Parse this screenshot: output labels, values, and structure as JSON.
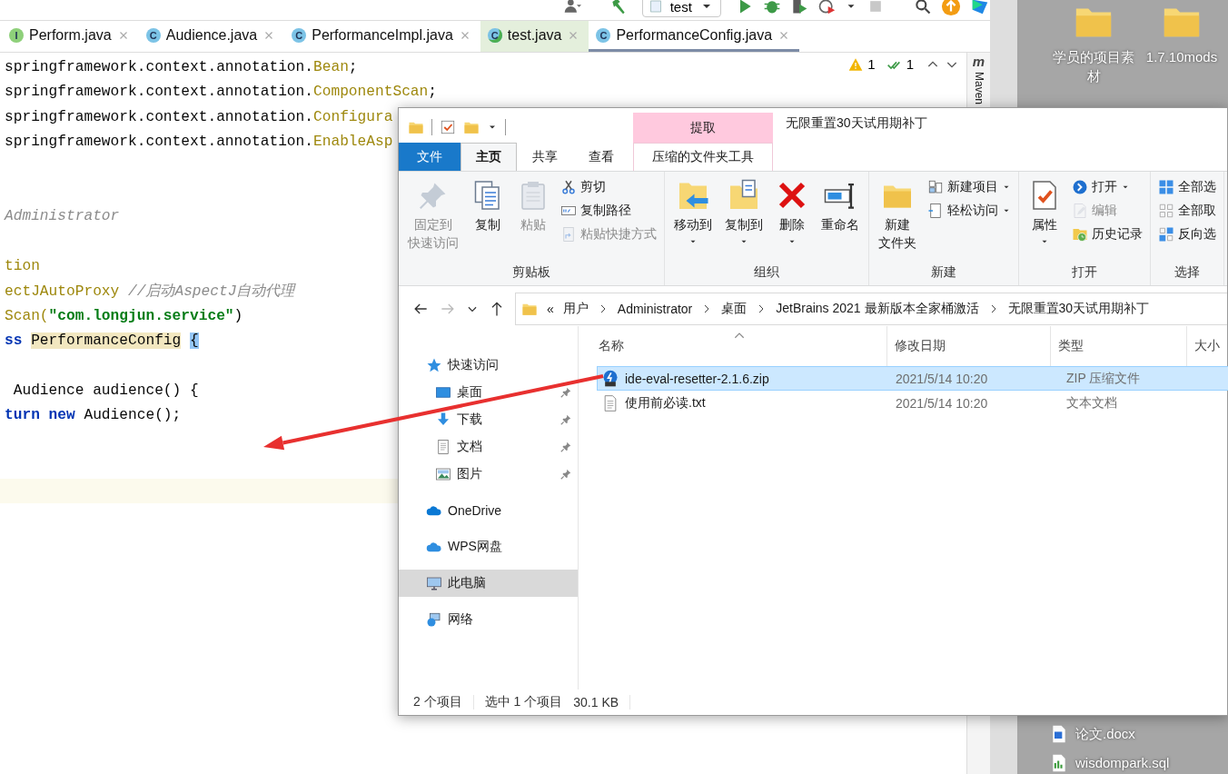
{
  "ide": {
    "toolbar": {
      "run_config": "test"
    },
    "tabs": [
      {
        "label": "Perform.java",
        "kind": "interface",
        "letter": "I",
        "color": "#ffffff",
        "selected": false
      },
      {
        "label": "Audience.java",
        "kind": "class",
        "letter": "C",
        "color": "#ffffff",
        "selected": false
      },
      {
        "label": "PerformanceImpl.java",
        "kind": "class",
        "letter": "C",
        "color": "#ffffff",
        "selected": false
      },
      {
        "label": "test.java",
        "kind": "runnable",
        "letter": "C",
        "color": "#e4efdc",
        "selected": false
      },
      {
        "label": "PerformanceConfig.java",
        "kind": "class",
        "letter": "C",
        "color": "#ffffff",
        "selected": true
      }
    ],
    "inspections": {
      "warnings": "1",
      "passed": "1"
    },
    "tool_strip": {
      "letter": "m",
      "label": "Maven"
    },
    "editor": {
      "lines": [
        {
          "current": false,
          "segments": [
            {
              "text": "springframework.context.annotation.",
              "kind": "plain"
            },
            {
              "text": "Bean",
              "kind": "type"
            },
            {
              "text": ";",
              "kind": "plain"
            }
          ]
        },
        {
          "current": false,
          "segments": [
            {
              "text": "springframework.context.annotation.",
              "kind": "plain"
            },
            {
              "text": "ComponentScan",
              "kind": "type"
            },
            {
              "text": ";",
              "kind": "plain"
            }
          ]
        },
        {
          "current": false,
          "segments": [
            {
              "text": "springframework.context.annotation.",
              "kind": "plain"
            },
            {
              "text": "Configura",
              "kind": "type"
            }
          ]
        },
        {
          "current": false,
          "segments": [
            {
              "text": "springframework.context.annotation.",
              "kind": "plain"
            },
            {
              "text": "EnableAsp",
              "kind": "type"
            }
          ]
        },
        {
          "current": false
        },
        {
          "current": false
        },
        {
          "current": false,
          "segments": [
            {
              "text": "Administrator",
              "kind": "doc"
            }
          ]
        },
        {
          "current": false
        },
        {
          "current": false,
          "segments": [
            {
              "text": "tion",
              "kind": "type"
            }
          ]
        },
        {
          "current": false,
          "segments": [
            {
              "text": "ectJAutoProxy ",
              "kind": "type"
            },
            {
              "text": "//启动AspectJ自动代理",
              "kind": "comment"
            }
          ]
        },
        {
          "current": false,
          "segments": [
            {
              "text": "Scan(",
              "kind": "type"
            },
            {
              "text": "\"com.longjun.service\"",
              "kind": "string"
            },
            {
              "text": ")",
              "kind": "plain"
            }
          ]
        },
        {
          "current": false,
          "segments": [
            {
              "text": "ss ",
              "kind": "keyword"
            },
            {
              "text": "PerformanceConfig",
              "kind": "usage"
            },
            {
              "text": "{",
              "kind": "brace"
            }
          ]
        },
        {
          "current": false
        },
        {
          "current": false,
          "segments": [
            {
              "text": " Audience audience() {",
              "kind": "plain"
            }
          ]
        },
        {
          "current": false,
          "segments": [
            {
              "text": "turn new ",
              "kind": "keyword"
            },
            {
              "text": "Audience();",
              "kind": "plain"
            }
          ]
        },
        {
          "current": false
        },
        {
          "current": false
        },
        {
          "current": true
        }
      ]
    }
  },
  "desktop": {
    "icons": [
      {
        "label": "学员的项目素材",
        "kind": "folder"
      },
      {
        "label": "1.7.10mods",
        "kind": "folder"
      }
    ],
    "files": [
      {
        "label": "论文.docx",
        "kind": "doc"
      },
      {
        "label": "wisdompark.sql",
        "kind": "sql"
      }
    ]
  },
  "explorer": {
    "title": "无限重置30天试用期补丁",
    "context_header": "提取",
    "tabs": [
      {
        "label": "文件",
        "kind": "file",
        "selected": false
      },
      {
        "label": "主页",
        "kind": "tab",
        "selected": true
      },
      {
        "label": "共享",
        "kind": "tab",
        "selected": false
      },
      {
        "label": "查看",
        "kind": "tab",
        "selected": false
      },
      {
        "label": "压缩的文件夹工具",
        "kind": "context",
        "selected": false
      }
    ],
    "ribbon": [
      {
        "label": "剪贴板",
        "items": [
          {
            "label_lines": [
              "固定到",
              "快速访问"
            ],
            "kind": "large",
            "disabled": true,
            "dropdown": false
          },
          {
            "label": "复制",
            "kind": "large",
            "disabled": false,
            "dropdown": false
          },
          {
            "label": "粘贴",
            "kind": "large",
            "disabled": true,
            "dropdown": false
          },
          {
            "label": "剪切",
            "kind": "small",
            "disabled": false,
            "dropdown": false
          },
          {
            "label": "复制路径",
            "kind": "small",
            "disabled": false,
            "dropdown": false
          },
          {
            "label": "粘贴快捷方式",
            "kind": "small",
            "disabled": true,
            "dropdown": false
          }
        ]
      },
      {
        "label": "组织",
        "items": [
          {
            "label": "移动到",
            "kind": "large",
            "disabled": false,
            "dropdown": true
          },
          {
            "label": "复制到",
            "kind": "large",
            "disabled": false,
            "dropdown": true
          },
          {
            "label": "删除",
            "kind": "large",
            "disabled": false,
            "dropdown": true
          },
          {
            "label": "重命名",
            "kind": "large",
            "disabled": false,
            "dropdown": false
          }
        ]
      },
      {
        "label": "新建",
        "items": [
          {
            "label_lines": [
              "新建",
              "文件夹"
            ],
            "kind": "large",
            "disabled": false,
            "dropdown": false
          },
          {
            "label": "新建项目",
            "kind": "small",
            "disabled": false,
            "dropdown": true
          },
          {
            "label": "轻松访问",
            "kind": "small",
            "disabled": false,
            "dropdown": true
          }
        ]
      },
      {
        "label": "打开",
        "items": [
          {
            "label": "属性",
            "kind": "large",
            "disabled": false,
            "dropdown": true
          },
          {
            "label": "打开",
            "kind": "small",
            "disabled": false,
            "dropdown": true
          },
          {
            "label": "编辑",
            "kind": "small",
            "disabled": true,
            "dropdown": false
          },
          {
            "label": "历史记录",
            "kind": "small",
            "disabled": false,
            "dropdown": false
          }
        ]
      },
      {
        "label": "选择",
        "items": [
          {
            "label": "全部选",
            "kind": "small",
            "disabled": false,
            "dropdown": false
          },
          {
            "label": "全部取",
            "kind": "small",
            "disabled": false,
            "dropdown": false
          },
          {
            "label": "反向选",
            "kind": "small",
            "disabled": false,
            "dropdown": false
          }
        ]
      }
    ],
    "history": {
      "back_enabled": true,
      "forward_enabled": false
    },
    "address": {
      "overflow": "«",
      "crumbs": [
        "用户",
        "Administrator",
        "桌面",
        "JetBrains 2021 最新版本全家桶激活",
        "无限重置30天试用期补丁"
      ]
    },
    "nav": [
      {
        "label": "快速访问",
        "selected": false,
        "children": [
          {
            "label": "桌面",
            "pinned": true,
            "selected": false
          },
          {
            "label": "下载",
            "pinned": true,
            "selected": false
          },
          {
            "label": "文档",
            "pinned": true,
            "selected": false
          },
          {
            "label": "图片",
            "pinned": true,
            "selected": false
          }
        ]
      },
      {
        "label": "OneDrive",
        "selected": false
      },
      {
        "label": "WPS网盘",
        "selected": false
      },
      {
        "label": "此电脑",
        "selected": true
      },
      {
        "label": "网络",
        "selected": false
      }
    ],
    "columns": [
      "名称",
      "修改日期",
      "类型",
      "大小"
    ],
    "files": [
      {
        "name": "ide-eval-resetter-2.1.6.zip",
        "date": "2021/5/14 10:20",
        "type": "ZIP 压缩文件",
        "kind": "zip",
        "selected": true
      },
      {
        "name": "使用前必读.txt",
        "date": "2021/5/14 10:20",
        "type": "文本文档",
        "kind": "txt",
        "selected": false
      }
    ],
    "status": {
      "count": "2 个项目",
      "selection": "选中 1 个项目",
      "size": "30.1 KB"
    }
  }
}
